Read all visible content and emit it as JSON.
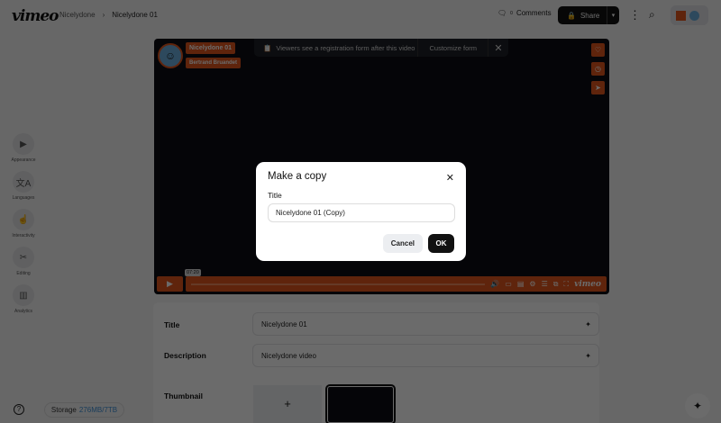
{
  "header": {
    "logo": "vimeo",
    "breadcrumb": [
      "Nicelydone",
      "Nicelydone 01"
    ],
    "comments_label": "Comments",
    "comments_count": "0",
    "share_label": "Share"
  },
  "sidebar": {
    "items": [
      {
        "label": "Appearance",
        "icon": "▶"
      },
      {
        "label": "Languages",
        "icon": "文A"
      },
      {
        "label": "Interactivity",
        "icon": "☝"
      },
      {
        "label": "Editing",
        "icon": "✂"
      },
      {
        "label": "Analytics",
        "icon": "▥"
      }
    ],
    "help": "?",
    "storage_label": "Storage",
    "storage_value": "276MB/7TB"
  },
  "player": {
    "title": "Nicelydone 01",
    "author": "Bertrand Bruandet",
    "banner_text": "Viewers see a registration form after this video",
    "customize": "Customize form",
    "time": "07:20",
    "logo": "vimeo"
  },
  "details": {
    "title_label": "Title",
    "title_value": "Nicelydone 01",
    "description_label": "Description",
    "description_value": "Nicelydone video",
    "thumbnail_label": "Thumbnail"
  },
  "modal": {
    "heading": "Make a copy",
    "field_label": "Title",
    "field_value": "Nicelydone 01 (Copy)",
    "cancel": "Cancel",
    "ok": "OK"
  },
  "colors": {
    "accent": "#e2561d"
  }
}
